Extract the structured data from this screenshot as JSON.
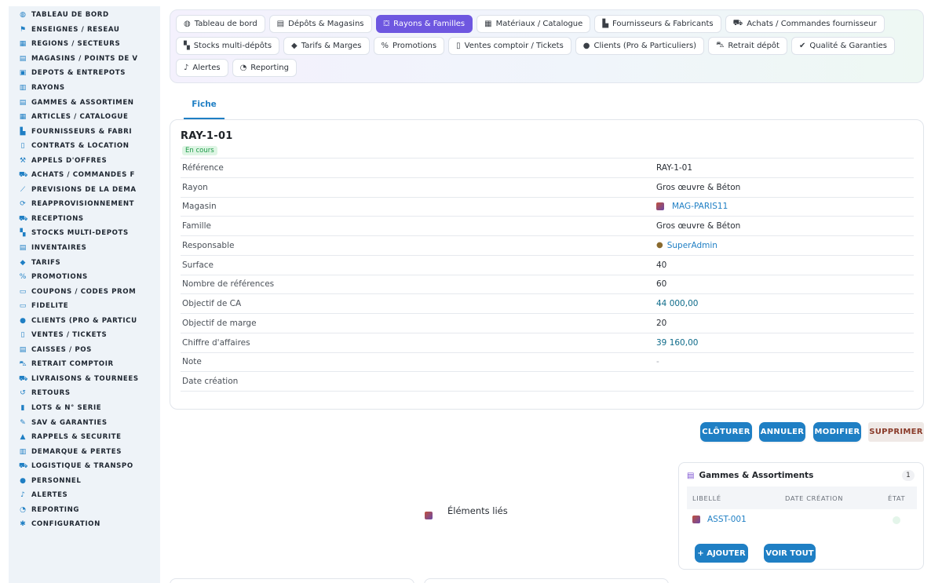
{
  "sidebar": {
    "items": [
      {
        "label": "TABLEAU DE BORD",
        "icon": "dashboard-icon",
        "glyph": "◍"
      },
      {
        "label": "ENSEIGNES / RÉSEAU",
        "icon": "flag-icon",
        "glyph": "⚑"
      },
      {
        "label": "RÉGIONS / SECTEURS",
        "icon": "map-icon",
        "glyph": "▦"
      },
      {
        "label": "MAGASINS / POINTS DE V",
        "icon": "store-icon",
        "glyph": "▤"
      },
      {
        "label": "DÉPÔTS & ENTREPÔTS",
        "icon": "warehouse-icon",
        "glyph": "▣"
      },
      {
        "label": "RAYONS",
        "icon": "shelf-icon",
        "glyph": "▥"
      },
      {
        "label": "GAMMES & ASSORTIMEN",
        "icon": "list-icon",
        "glyph": "▤"
      },
      {
        "label": "ARTICLES / CATALOGUE",
        "icon": "catalog-icon",
        "glyph": "▦"
      },
      {
        "label": "FOURNISSEURS & FABRI",
        "icon": "factory-icon",
        "glyph": "▙"
      },
      {
        "label": "CONTRATS & LOCATION",
        "icon": "contract-icon",
        "glyph": "▯"
      },
      {
        "label": "APPELS D'OFFRES",
        "icon": "gavel-icon",
        "glyph": "⚒"
      },
      {
        "label": "ACHATS / COMMANDES F",
        "icon": "cart-icon",
        "glyph": "⛟"
      },
      {
        "label": "PRÉVISIONS DE LA DEMA",
        "icon": "chart-line-icon",
        "glyph": "⟋"
      },
      {
        "label": "RÉAPPROVISIONNEMENT",
        "icon": "refresh-icon",
        "glyph": "⟳"
      },
      {
        "label": "RÉCEPTIONS",
        "icon": "cart-plus-icon",
        "glyph": "⛟"
      },
      {
        "label": "STOCKS MULTI-DÉPÔTS",
        "icon": "boxes-icon",
        "glyph": "▚"
      },
      {
        "label": "INVENTAIRES",
        "icon": "clipboard-icon",
        "glyph": "▤"
      },
      {
        "label": "TARIFS",
        "icon": "tag-icon",
        "glyph": "◆"
      },
      {
        "label": "PROMOTIONS",
        "icon": "percent-icon",
        "glyph": "%"
      },
      {
        "label": "COUPONS / CODES PROM",
        "icon": "ticket-icon",
        "glyph": "▭"
      },
      {
        "label": "FIDÉLITÉ",
        "icon": "card-icon",
        "glyph": "▭"
      },
      {
        "label": "CLIENTS (PRO & PARTICU",
        "icon": "user-icon",
        "glyph": "●"
      },
      {
        "label": "VENTES / TICKETS",
        "icon": "receipt-icon",
        "glyph": "▯"
      },
      {
        "label": "CAISSES / POS",
        "icon": "cash-register-icon",
        "glyph": "▤"
      },
      {
        "label": "RETRAIT COMPTOIR",
        "icon": "car-icon",
        "glyph": "⛍"
      },
      {
        "label": "LIVRAISONS & TOURNÉES",
        "icon": "truck-icon",
        "glyph": "⛟"
      },
      {
        "label": "RETOURS",
        "icon": "undo-icon",
        "glyph": "↺"
      },
      {
        "label": "LOTS & N° SÉRIE",
        "icon": "barcode-icon",
        "glyph": "▮"
      },
      {
        "label": "SAV & GARANTIES",
        "icon": "wrench-icon",
        "glyph": "✎"
      },
      {
        "label": "RAPPELS & SÉCURITÉ",
        "icon": "warning-icon",
        "glyph": "▲"
      },
      {
        "label": "DÉMARQUE & PERTES",
        "icon": "trash-icon",
        "glyph": "▥"
      },
      {
        "label": "LOGISTIQUE & TRANSPO",
        "icon": "dolly-icon",
        "glyph": "⛟"
      },
      {
        "label": "PERSONNEL",
        "icon": "users-icon",
        "glyph": "●"
      },
      {
        "label": "ALERTES",
        "icon": "bell-icon",
        "glyph": "♪"
      },
      {
        "label": "REPORTING",
        "icon": "pie-chart-icon",
        "glyph": "◔"
      },
      {
        "label": "CONFIGURATION",
        "icon": "gear-icon",
        "glyph": "✱"
      }
    ]
  },
  "tabs": [
    {
      "label": "Tableau de bord",
      "icon": "dashboard-icon",
      "glyph": "◍",
      "active": false
    },
    {
      "label": "Dépôts & Magasins",
      "icon": "warehouse-icon",
      "glyph": "▤",
      "active": false
    },
    {
      "label": "Rayons & Familles",
      "icon": "basket-icon",
      "glyph": "⛋",
      "active": true
    },
    {
      "label": "Matériaux / Catalogue",
      "icon": "catalog-icon",
      "glyph": "▦",
      "active": false
    },
    {
      "label": "Fournisseurs & Fabricants",
      "icon": "factory-icon",
      "glyph": "▙",
      "active": false
    },
    {
      "label": "Achats / Commandes fournisseur",
      "icon": "cart-icon",
      "glyph": "⛟",
      "active": false
    },
    {
      "label": "Stocks multi-dépôts",
      "icon": "boxes-icon",
      "glyph": "▚",
      "active": false
    },
    {
      "label": "Tarifs & Marges",
      "icon": "tags-icon",
      "glyph": "◆",
      "active": false
    },
    {
      "label": "Promotions",
      "icon": "percent-icon",
      "glyph": "%",
      "active": false
    },
    {
      "label": "Ventes comptoir / Tickets",
      "icon": "receipt-icon",
      "glyph": "▯",
      "active": false
    },
    {
      "label": "Clients (Pro & Particuliers)",
      "icon": "user-icon",
      "glyph": "●",
      "active": false
    },
    {
      "label": "Retrait dépôt",
      "icon": "car-icon",
      "glyph": "⛍",
      "active": false
    },
    {
      "label": "Qualité & Garanties",
      "icon": "check-double-icon",
      "glyph": "✔",
      "active": false
    },
    {
      "label": "Alertes",
      "icon": "bell-icon",
      "glyph": "♪",
      "active": false
    },
    {
      "label": "Reporting",
      "icon": "pie-chart-icon",
      "glyph": "◔",
      "active": false
    }
  ],
  "subtab": {
    "label": "Fiche"
  },
  "record": {
    "title": "RAY-1-01",
    "status": "En cours",
    "fields": [
      {
        "key": "Référence",
        "value": "RAY-1-01",
        "style": ""
      },
      {
        "key": "Rayon",
        "value": "Gros œuvre & Béton",
        "style": ""
      },
      {
        "key": "Magasin",
        "value": "MAG-PARIS11",
        "style": "link",
        "icon": "store-thumb-icon"
      },
      {
        "key": "Famille",
        "value": "Gros œuvre & Béton",
        "style": ""
      },
      {
        "key": "Responsable",
        "value": "SuperAdmin",
        "style": "link",
        "icon": "user-icon"
      },
      {
        "key": "Surface",
        "value": "40",
        "style": ""
      },
      {
        "key": "Nombre de références",
        "value": "60",
        "style": ""
      },
      {
        "key": "Objectif de CA",
        "value": "44 000,00",
        "style": "money"
      },
      {
        "key": "Objectif de marge",
        "value": "20",
        "style": ""
      },
      {
        "key": "Chiffre d'affaires",
        "value": "39 160,00",
        "style": "money"
      },
      {
        "key": "Note",
        "value": "-",
        "style": "muted"
      },
      {
        "key": "Date création",
        "value": "",
        "style": ""
      }
    ]
  },
  "actions": {
    "close": "CLÔTURER",
    "cancel": "ANNULER",
    "edit": "MODIFIER",
    "delete": "SUPPRIMER"
  },
  "linked": {
    "label": "Éléments liés"
  },
  "gammes_panel": {
    "title": "Gammes & Assortiments",
    "count": "1",
    "columns": [
      "LIBELLÉ",
      "DATE CRÉATION",
      "ÉTAT"
    ],
    "rows": [
      {
        "label": "ASST-001",
        "date": "",
        "state": ""
      }
    ],
    "add_label": "+ AJOUTER",
    "view_all_label": "VOIR TOUT"
  }
}
